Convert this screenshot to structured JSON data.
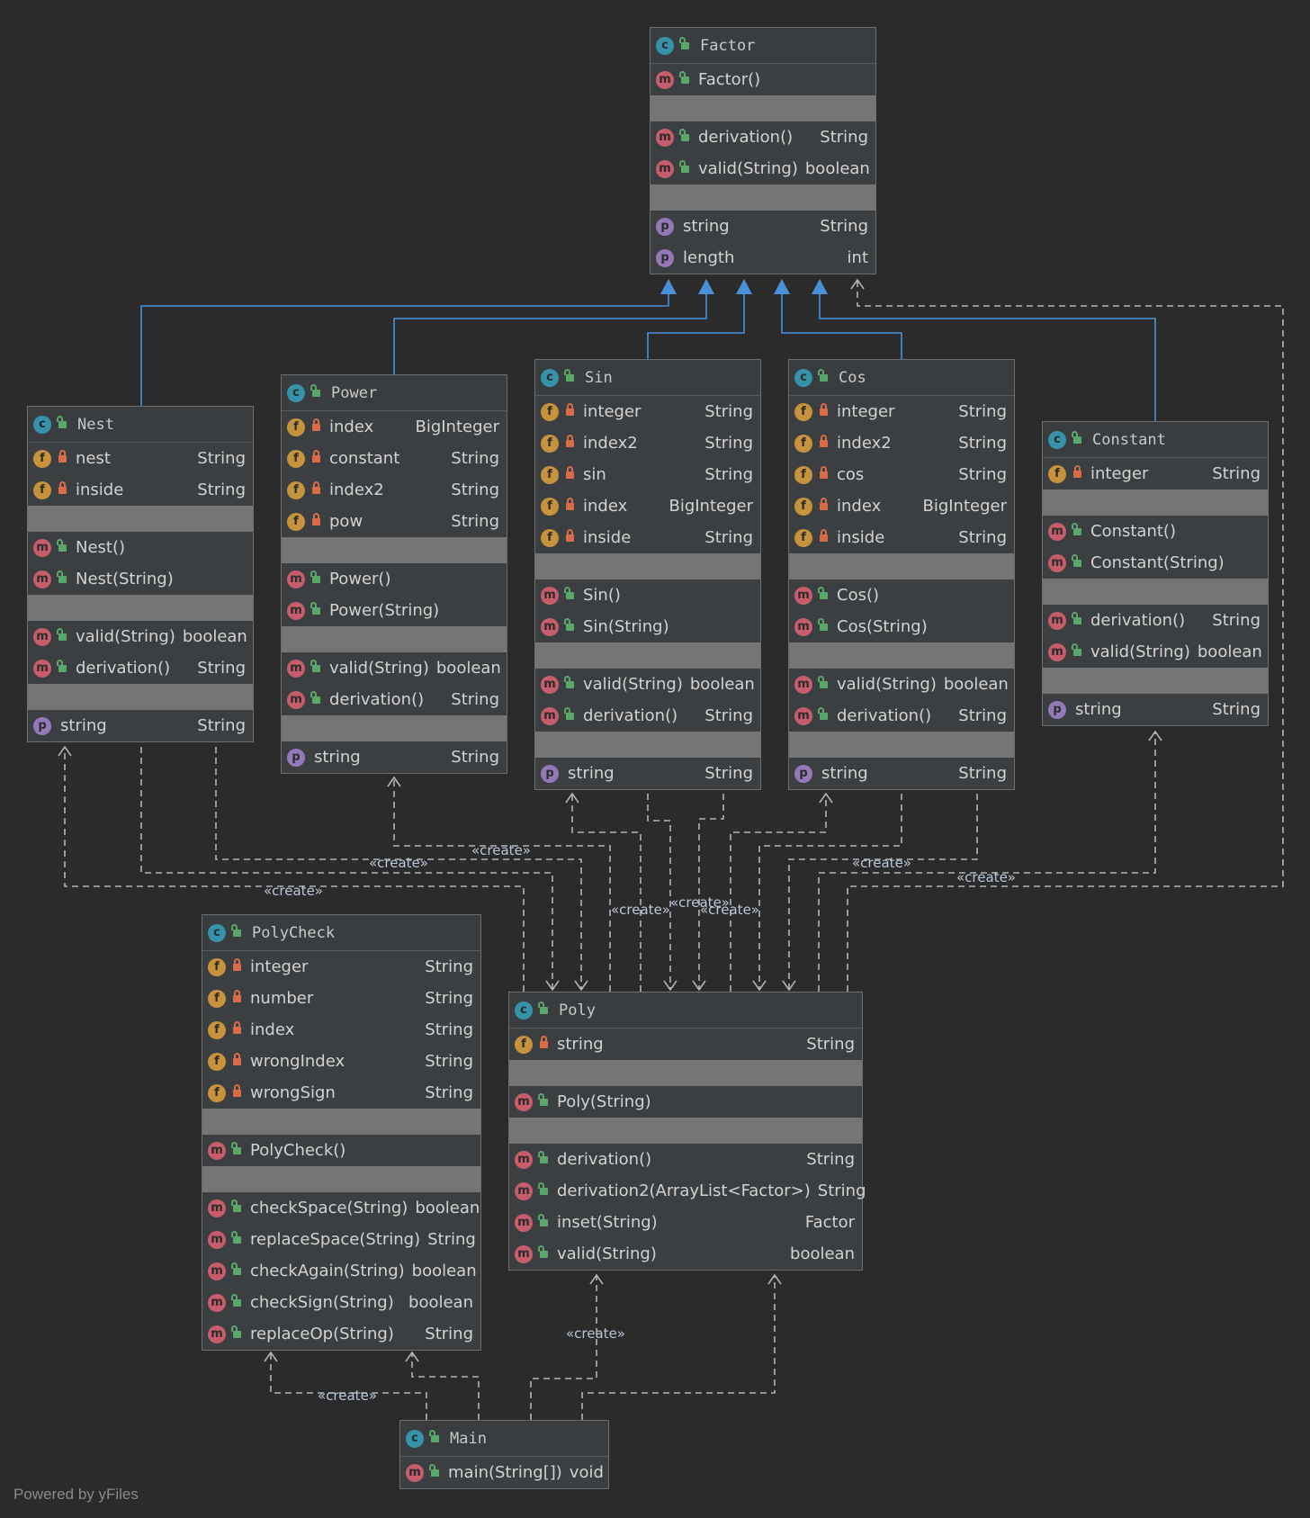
{
  "classes": {
    "factor": {
      "name": "Factor",
      "rows": [
        {
          "kind": "m",
          "vis": "public",
          "name": "Factor()",
          "type": ""
        },
        {
          "sep": true
        },
        {
          "kind": "m",
          "vis": "public",
          "name": "derivation()",
          "type": "String"
        },
        {
          "kind": "m",
          "vis": "public",
          "name": "valid(String)",
          "type": "boolean"
        },
        {
          "sep": true
        },
        {
          "kind": "p",
          "name": "string",
          "type": "String"
        },
        {
          "kind": "p",
          "name": "length",
          "type": "int"
        }
      ]
    },
    "nest": {
      "name": "Nest",
      "rows": [
        {
          "kind": "f",
          "vis": "private",
          "name": "nest",
          "type": "String"
        },
        {
          "kind": "f",
          "vis": "private",
          "name": "inside",
          "type": "String"
        },
        {
          "sep": true
        },
        {
          "kind": "m",
          "vis": "public",
          "name": "Nest()",
          "type": ""
        },
        {
          "kind": "m",
          "vis": "public",
          "name": "Nest(String)",
          "type": ""
        },
        {
          "sep": true
        },
        {
          "kind": "m",
          "vis": "public",
          "name": "valid(String)",
          "type": "boolean"
        },
        {
          "kind": "m",
          "vis": "public",
          "name": "derivation()",
          "type": "String"
        },
        {
          "sep": true
        },
        {
          "kind": "p",
          "name": "string",
          "type": "String"
        }
      ]
    },
    "power": {
      "name": "Power",
      "rows": [
        {
          "kind": "f",
          "vis": "private",
          "name": "index",
          "type": "BigInteger"
        },
        {
          "kind": "f",
          "vis": "private",
          "name": "constant",
          "type": "String"
        },
        {
          "kind": "f",
          "vis": "private",
          "name": "index2",
          "type": "String"
        },
        {
          "kind": "f",
          "vis": "private",
          "name": "pow",
          "type": "String"
        },
        {
          "sep": true
        },
        {
          "kind": "m",
          "vis": "public",
          "name": "Power()",
          "type": ""
        },
        {
          "kind": "m",
          "vis": "public",
          "name": "Power(String)",
          "type": ""
        },
        {
          "sep": true
        },
        {
          "kind": "m",
          "vis": "public",
          "name": "valid(String)",
          "type": "boolean"
        },
        {
          "kind": "m",
          "vis": "public",
          "name": "derivation()",
          "type": "String"
        },
        {
          "sep": true
        },
        {
          "kind": "p",
          "name": "string",
          "type": "String"
        }
      ]
    },
    "sin": {
      "name": "Sin",
      "rows": [
        {
          "kind": "f",
          "vis": "private",
          "name": "integer",
          "type": "String"
        },
        {
          "kind": "f",
          "vis": "private",
          "name": "index2",
          "type": "String"
        },
        {
          "kind": "f",
          "vis": "private",
          "name": "sin",
          "type": "String"
        },
        {
          "kind": "f",
          "vis": "private",
          "name": "index",
          "type": "BigInteger"
        },
        {
          "kind": "f",
          "vis": "private",
          "name": "inside",
          "type": "String"
        },
        {
          "sep": true
        },
        {
          "kind": "m",
          "vis": "public",
          "name": "Sin()",
          "type": ""
        },
        {
          "kind": "m",
          "vis": "public",
          "name": "Sin(String)",
          "type": ""
        },
        {
          "sep": true
        },
        {
          "kind": "m",
          "vis": "public",
          "name": "valid(String)",
          "type": "boolean"
        },
        {
          "kind": "m",
          "vis": "public",
          "name": "derivation()",
          "type": "String"
        },
        {
          "sep": true
        },
        {
          "kind": "p",
          "name": "string",
          "type": "String"
        }
      ]
    },
    "cos": {
      "name": "Cos",
      "rows": [
        {
          "kind": "f",
          "vis": "private",
          "name": "integer",
          "type": "String"
        },
        {
          "kind": "f",
          "vis": "private",
          "name": "index2",
          "type": "String"
        },
        {
          "kind": "f",
          "vis": "private",
          "name": "cos",
          "type": "String"
        },
        {
          "kind": "f",
          "vis": "private",
          "name": "index",
          "type": "BigInteger"
        },
        {
          "kind": "f",
          "vis": "private",
          "name": "inside",
          "type": "String"
        },
        {
          "sep": true
        },
        {
          "kind": "m",
          "vis": "public",
          "name": "Cos()",
          "type": ""
        },
        {
          "kind": "m",
          "vis": "public",
          "name": "Cos(String)",
          "type": ""
        },
        {
          "sep": true
        },
        {
          "kind": "m",
          "vis": "public",
          "name": "valid(String)",
          "type": "boolean"
        },
        {
          "kind": "m",
          "vis": "public",
          "name": "derivation()",
          "type": "String"
        },
        {
          "sep": true
        },
        {
          "kind": "p",
          "name": "string",
          "type": "String"
        }
      ]
    },
    "constant": {
      "name": "Constant",
      "rows": [
        {
          "kind": "f",
          "vis": "private",
          "name": "integer",
          "type": "String"
        },
        {
          "sep": true
        },
        {
          "kind": "m",
          "vis": "public",
          "name": "Constant()",
          "type": ""
        },
        {
          "kind": "m",
          "vis": "public",
          "name": "Constant(String)",
          "type": ""
        },
        {
          "sep": true
        },
        {
          "kind": "m",
          "vis": "public",
          "name": "derivation()",
          "type": "String"
        },
        {
          "kind": "m",
          "vis": "public",
          "name": "valid(String)",
          "type": "boolean"
        },
        {
          "sep": true
        },
        {
          "kind": "p",
          "name": "string",
          "type": "String"
        }
      ]
    },
    "polycheck": {
      "name": "PolyCheck",
      "rows": [
        {
          "kind": "f",
          "vis": "private",
          "name": "integer",
          "type": "String"
        },
        {
          "kind": "f",
          "vis": "private",
          "name": "number",
          "type": "String"
        },
        {
          "kind": "f",
          "vis": "private",
          "name": "index",
          "type": "String"
        },
        {
          "kind": "f",
          "vis": "private",
          "name": "wrongIndex",
          "type": "String"
        },
        {
          "kind": "f",
          "vis": "private",
          "name": "wrongSign",
          "type": "String"
        },
        {
          "sep": true
        },
        {
          "kind": "m",
          "vis": "public",
          "name": "PolyCheck()",
          "type": ""
        },
        {
          "sep": true
        },
        {
          "kind": "m",
          "vis": "public",
          "name": "checkSpace(String)",
          "type": "boolean"
        },
        {
          "kind": "m",
          "vis": "public",
          "name": "replaceSpace(String)",
          "type": "String"
        },
        {
          "kind": "m",
          "vis": "public",
          "name": "checkAgain(String)",
          "type": "boolean"
        },
        {
          "kind": "m",
          "vis": "public",
          "name": "checkSign(String)",
          "type": "boolean"
        },
        {
          "kind": "m",
          "vis": "public",
          "name": "replaceOp(String)",
          "type": "String"
        }
      ]
    },
    "poly": {
      "name": "Poly",
      "rows": [
        {
          "kind": "f",
          "vis": "private",
          "name": "string",
          "type": "String"
        },
        {
          "sep": true
        },
        {
          "kind": "m",
          "vis": "public",
          "name": "Poly(String)",
          "type": ""
        },
        {
          "sep": true
        },
        {
          "kind": "m",
          "vis": "public",
          "name": "derivation()",
          "type": "String"
        },
        {
          "kind": "m",
          "vis": "public",
          "name": "derivation2(ArrayList<Factor>)",
          "type": "String"
        },
        {
          "kind": "m",
          "vis": "public",
          "name": "inset(String)",
          "type": "Factor"
        },
        {
          "kind": "m",
          "vis": "public",
          "name": "valid(String)",
          "type": "boolean"
        }
      ]
    },
    "main": {
      "name": "Main",
      "rows": [
        {
          "kind": "m",
          "vis": "public",
          "name": "main(String[])",
          "type": "void"
        }
      ]
    }
  },
  "edge_label": "«create»",
  "footer": "Powered by yFiles",
  "colors": {
    "inherit": "#4a90d9",
    "depend": "#b3b3b3"
  }
}
